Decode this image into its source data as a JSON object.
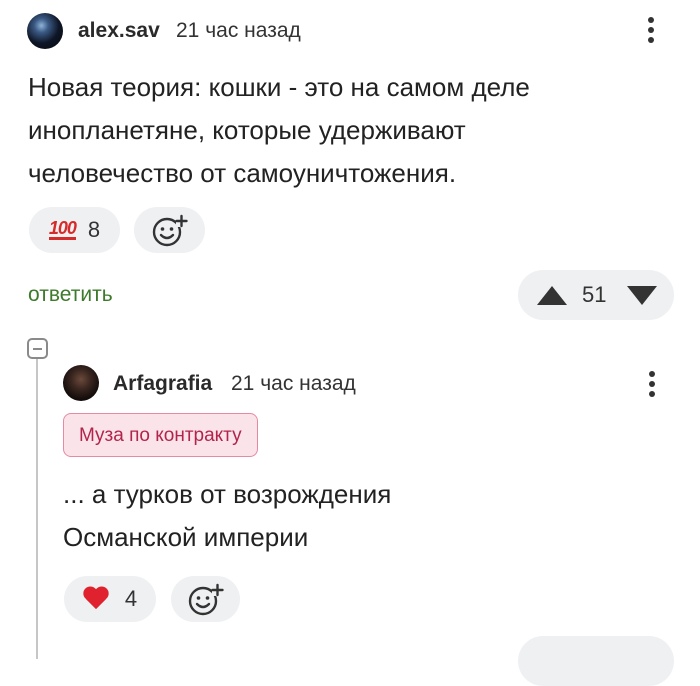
{
  "comment1": {
    "username": "alex.sav",
    "time": "21 час назад",
    "text": "Новая теория: кошки - это на самом деле\nинопланетяне, которые удерживают\nчеловечество от самоуничтожения.",
    "reaction": {
      "emoji": "100",
      "count": "8"
    },
    "reply_label": "ответить",
    "score": "51"
  },
  "comment2": {
    "username": "Arfagrafia",
    "time": "21 час назад",
    "badge": "Муза по контракту",
    "text": "... а турков от возрождения\nОсманской империи",
    "reaction": {
      "emoji": "heart",
      "count": "4"
    }
  },
  "colors": {
    "reply_link": "#3d7a2a",
    "badge_text": "#b1244b",
    "badge_bg": "#fbe3ea",
    "pill_bg": "#eef0f2",
    "heart": "#e0212e"
  }
}
